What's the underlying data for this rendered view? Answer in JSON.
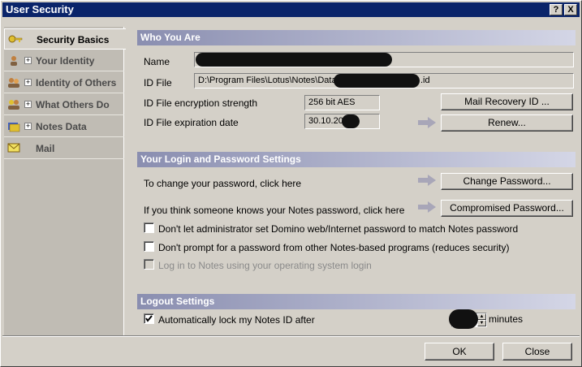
{
  "window": {
    "title": "User Security"
  },
  "titlebar": {
    "help": "?",
    "close": "X"
  },
  "sidebar": {
    "items": [
      {
        "label": "Security Basics",
        "icon": "key-icon"
      },
      {
        "label": "Your Identity",
        "icon": "person-icon"
      },
      {
        "label": "Identity of Others",
        "icon": "people-icon"
      },
      {
        "label": "What Others Do",
        "icon": "group-icon"
      },
      {
        "label": "Notes Data",
        "icon": "database-icon"
      },
      {
        "label": "Mail",
        "icon": "mail-icon"
      }
    ]
  },
  "who": {
    "header": "Who You Are",
    "name_label": "Name",
    "name_value": "",
    "idfile_label": "ID File",
    "idfile_value": "D:\\Program Files\\Lotus\\Notes\\Data",
    "idfile_suffix": ".id",
    "encryption_label": "ID File encryption strength",
    "encryption_value": "256 bit AES",
    "expiration_label": "ID File expiration date",
    "expiration_value": "30.10.20",
    "mail_recovery_button": "Mail Recovery ID ...",
    "renew_button": "Renew..."
  },
  "login": {
    "header": "Your Login and Password Settings",
    "change_text": "To change your password, click here",
    "change_button": "Change Password...",
    "compromised_text": "If you think someone knows your Notes password, click here",
    "compromised_button": "Compromised Password...",
    "opt1": "Don't let administrator set Domino web/Internet password to match Notes password",
    "opt2": "Don't prompt for a password from other Notes-based programs (reduces security)",
    "opt3": "Log in to Notes using your operating system login"
  },
  "logout": {
    "header": "Logout Settings",
    "autolock_label": "Automatically lock my Notes ID after",
    "autolock_checked": true,
    "minutes_label": "minutes"
  },
  "footer": {
    "ok_button": "OK",
    "close_button": "Close"
  }
}
